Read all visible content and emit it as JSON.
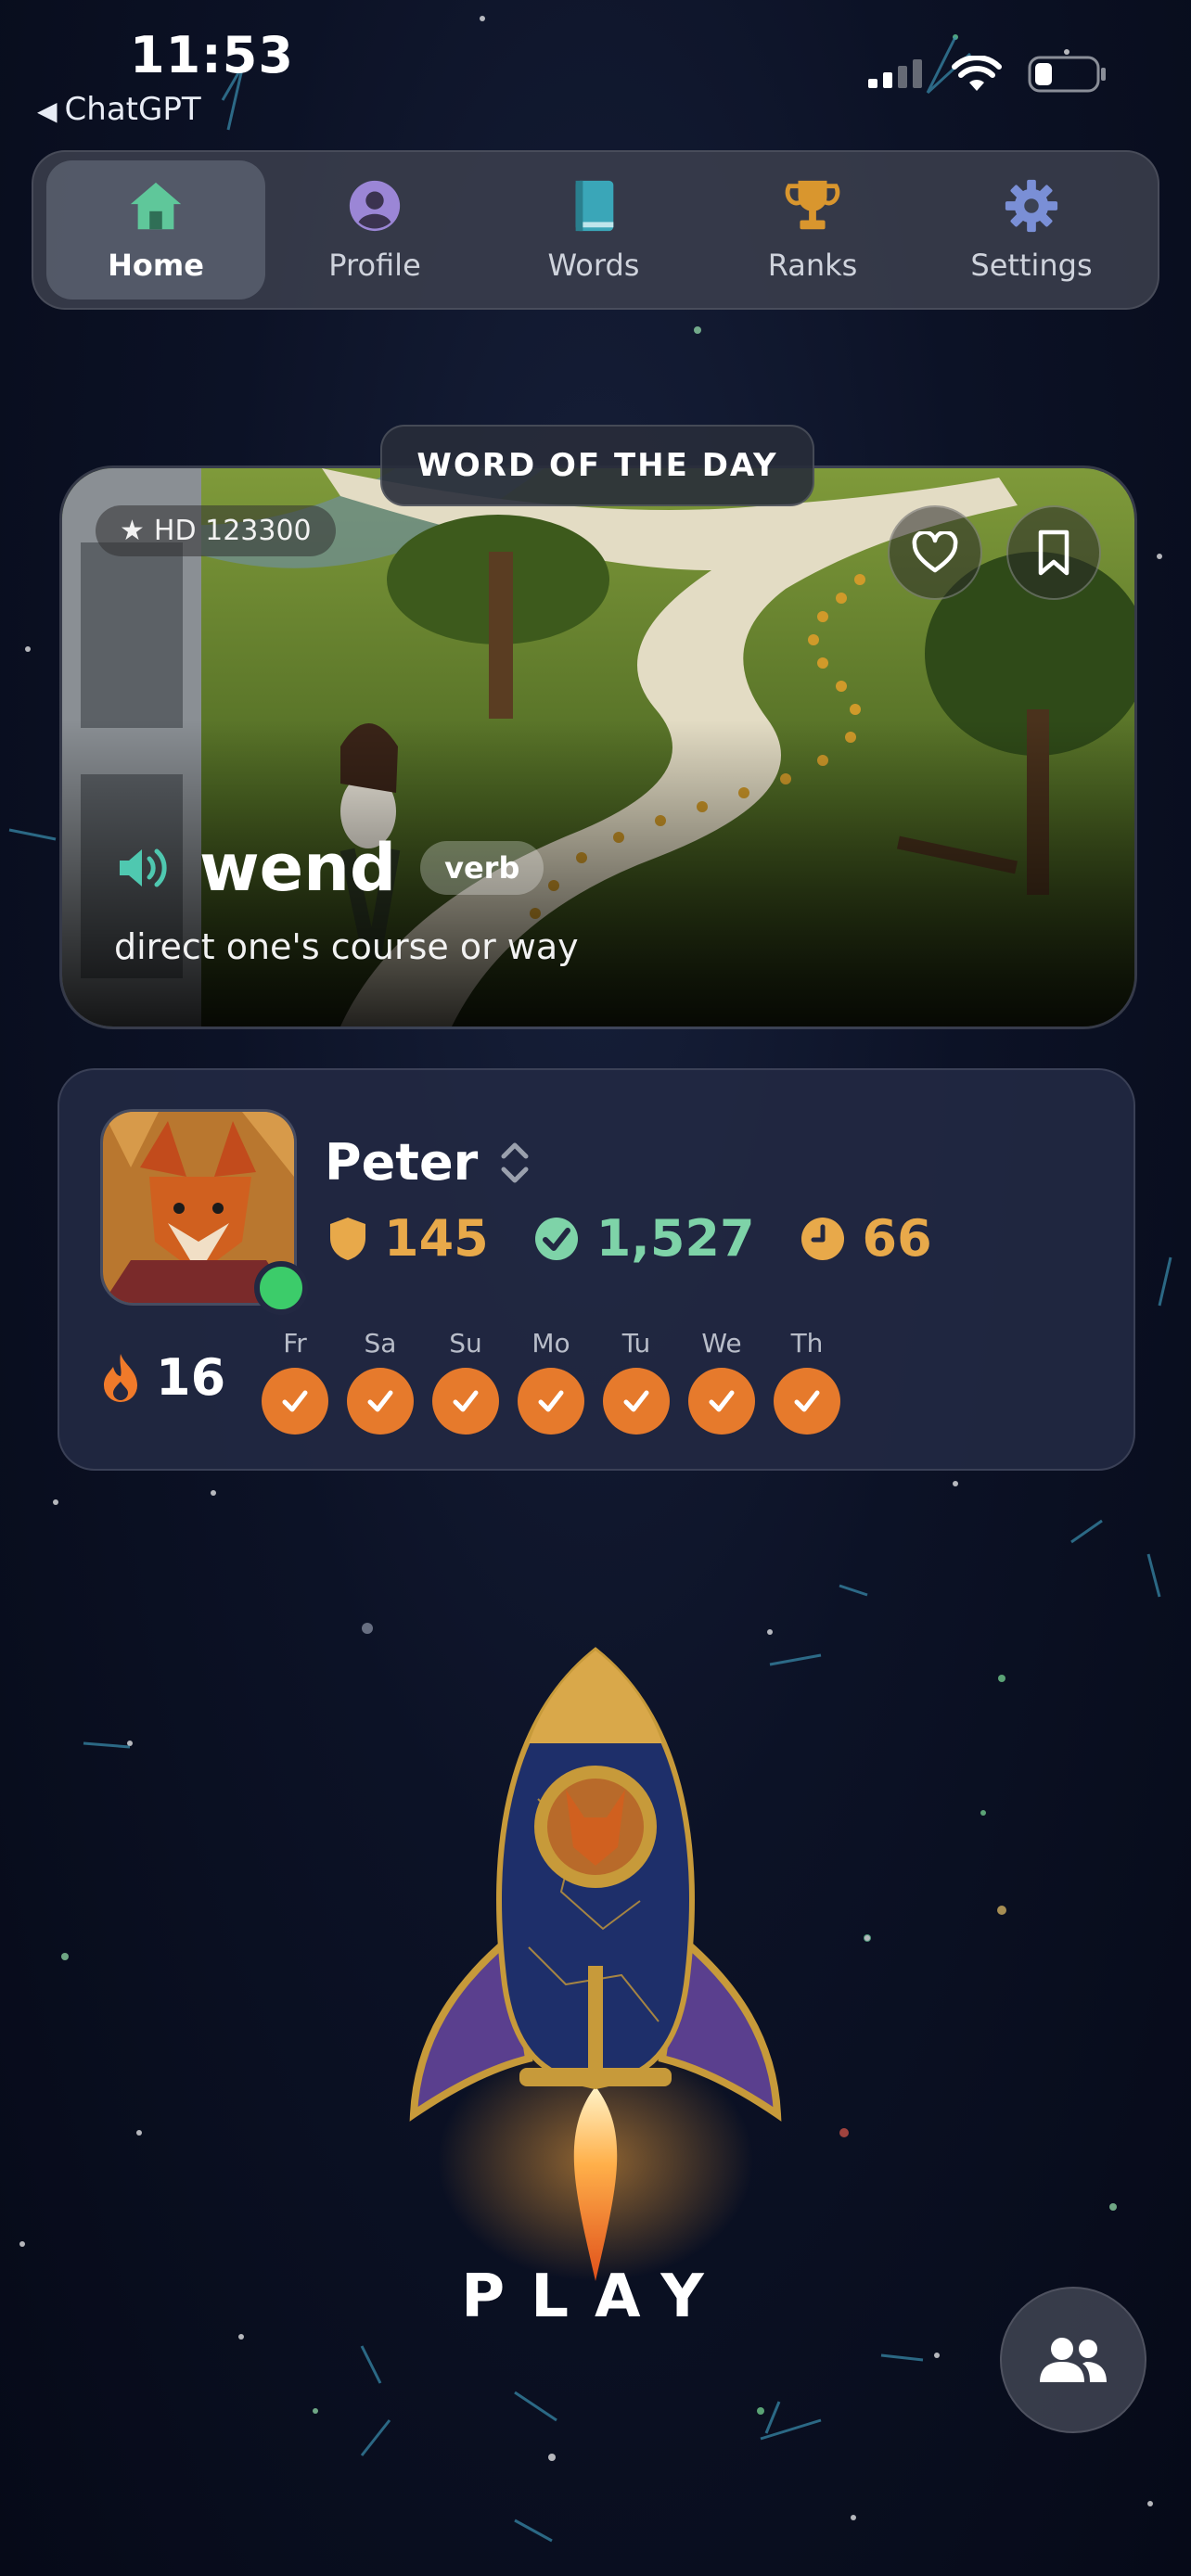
{
  "status_bar": {
    "time": "11:53",
    "back_label": "ChatGPT"
  },
  "nav": {
    "items": [
      {
        "label": "Home",
        "icon": "home-icon",
        "active": true
      },
      {
        "label": "Profile",
        "icon": "profile-icon",
        "active": false
      },
      {
        "label": "Words",
        "icon": "book-icon",
        "active": false
      },
      {
        "label": "Ranks",
        "icon": "trophy-icon",
        "active": false
      },
      {
        "label": "Settings",
        "icon": "gear-icon",
        "active": false
      }
    ],
    "colors": {
      "home": "#5fc79a",
      "profile": "#9b86d6",
      "words": "#3aa6b8",
      "ranks": "#d9962e",
      "settings": "#7a8fd6"
    }
  },
  "word_of_day": {
    "badge": "WORD OF THE DAY",
    "hd_label": "HD 123300",
    "word": "wend",
    "part_of_speech": "verb",
    "definition": "direct one's course or way"
  },
  "profile": {
    "name": "Peter",
    "stats": {
      "shields": "145",
      "correct": "1,527",
      "time": "66"
    },
    "streak": "16",
    "days": [
      "Fr",
      "Sa",
      "Su",
      "Mo",
      "Tu",
      "We",
      "Th"
    ]
  },
  "play_label": "PLAY"
}
